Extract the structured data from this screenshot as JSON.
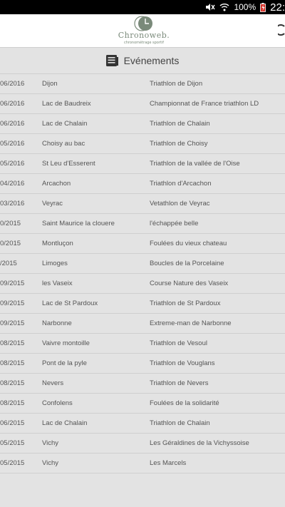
{
  "status": {
    "battery": "100%",
    "time": "22:"
  },
  "header": {
    "logo_text": "Chronoweb.",
    "logo_tagline": "chronométrage sportif"
  },
  "page": {
    "title": "Evénements"
  },
  "events": [
    {
      "date": "06/2016",
      "location": "Dijon",
      "name": "Triathlon de Dijon"
    },
    {
      "date": "06/2016",
      "location": "Lac de Baudreix",
      "name": "Championnat de France triathlon LD"
    },
    {
      "date": "06/2016",
      "location": "Lac de Chalain",
      "name": "Triathlon de Chalain"
    },
    {
      "date": "05/2016",
      "location": "Choisy au bac",
      "name": "Triathlon de Choisy"
    },
    {
      "date": "05/2016",
      "location": "St Leu d'Esserent",
      "name": "Triathlon de la vallée de l'Oise"
    },
    {
      "date": "04/2016",
      "location": "Arcachon",
      "name": "Triathlon d'Arcachon"
    },
    {
      "date": "03/2016",
      "location": "Veyrac",
      "name": "Vetathlon de Veyrac"
    },
    {
      "date": "0/2015",
      "location": "Saint Maurice la clouere",
      "name": "l'échappée belle"
    },
    {
      "date": "0/2015",
      "location": "Montluçon",
      "name": "Foulées du vieux chateau"
    },
    {
      "date": "/2015",
      "location": "Limoges",
      "name": "Boucles de la Porcelaine"
    },
    {
      "date": "09/2015",
      "location": "les Vaseix",
      "name": "Course Nature des Vaseix"
    },
    {
      "date": "09/2015",
      "location": "Lac de St Pardoux",
      "name": "Triathlon de St Pardoux"
    },
    {
      "date": "09/2015",
      "location": "Narbonne",
      "name": "Extreme-man de Narbonne"
    },
    {
      "date": "08/2015",
      "location": "Vaivre montoille",
      "name": "Triathlon de Vesoul"
    },
    {
      "date": "08/2015",
      "location": "Pont de la pyle",
      "name": "Triathlon de Vouglans"
    },
    {
      "date": "08/2015",
      "location": "Nevers",
      "name": "Triathlon de Nevers"
    },
    {
      "date": "08/2015",
      "location": "Confolens",
      "name": "Foulées de la solidarité"
    },
    {
      "date": "06/2015",
      "location": "Lac de Chalain",
      "name": "Triathlon de Chalain"
    },
    {
      "date": "05/2015",
      "location": "Vichy",
      "name": "Les Géraldines de la Vichyssoise"
    },
    {
      "date": "05/2015",
      "location": "Vichy",
      "name": "Les Marcels"
    }
  ]
}
